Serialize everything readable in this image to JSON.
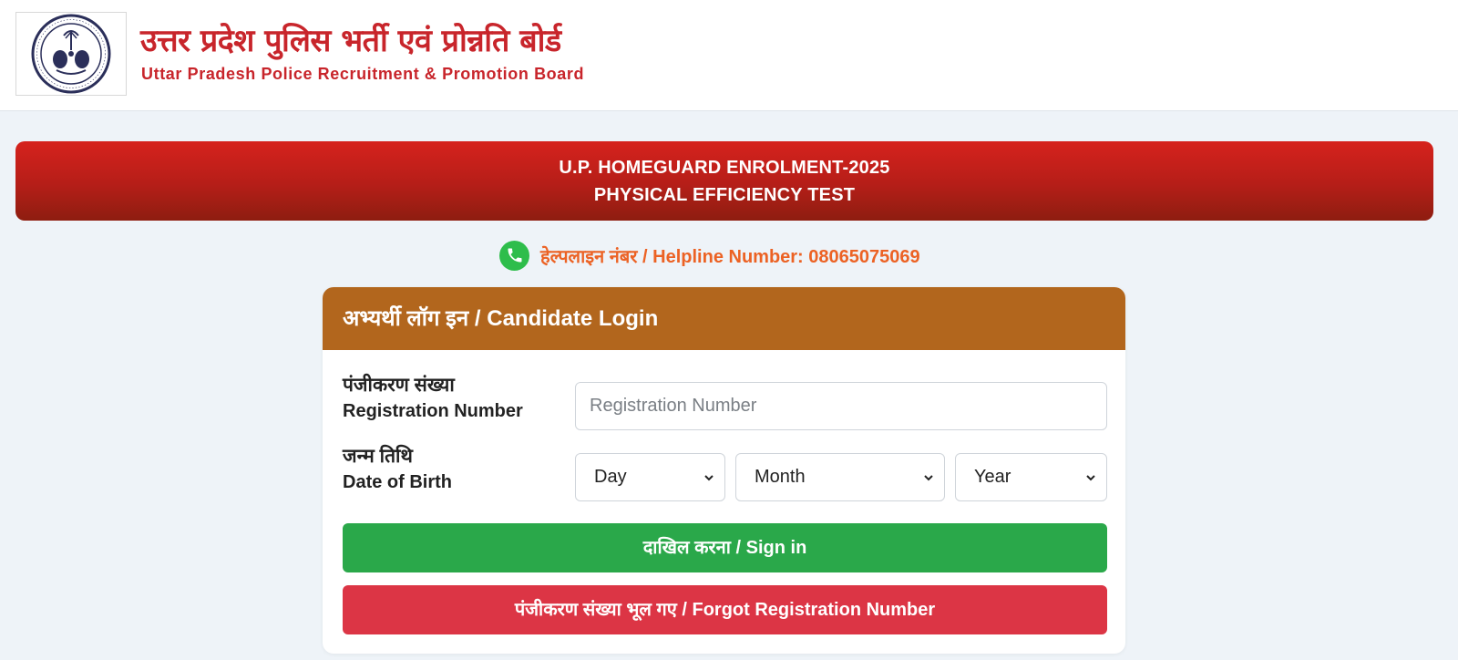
{
  "header": {
    "title_hindi": "उत्तर प्रदेश पुलिस भर्ती एवं प्रोन्नति बोर्ड",
    "title_english": "Uttar Pradesh Police Recruitment & Promotion Board",
    "logo_icon": "uppbpb-emblem-icon"
  },
  "banner": {
    "line1": "U.P. HOMEGUARD ENROLMENT-2025",
    "line2": "PHYSICAL EFFICIENCY TEST"
  },
  "helpline": {
    "icon": "phone-icon",
    "text": "हेल्पलाइन नंबर / Helpline Number: 08065075069"
  },
  "login": {
    "title": "अभ्यर्थी लॉग इन / Candidate Login",
    "registration": {
      "label_hindi": "पंजीकरण संख्या",
      "label_english": "Registration Number",
      "placeholder": "Registration Number",
      "value": ""
    },
    "dob": {
      "label_hindi": "जन्म तिथि",
      "label_english": "Date of Birth",
      "day": "Day",
      "month": "Month",
      "year": "Year"
    },
    "signin_label": "दाखिल करना / Sign in",
    "forgot_label": "पंजीकरण संख्या भूल गए / Forgot Registration Number"
  },
  "colors": {
    "brand_red": "#c8252b",
    "banner_red": "#c41f1a",
    "helpline_orange": "#ec6224",
    "card_header_brown": "#b2661d",
    "signin_green": "#2aa84a",
    "forgot_red": "#dc3545",
    "phone_green": "#2ebd4b"
  }
}
